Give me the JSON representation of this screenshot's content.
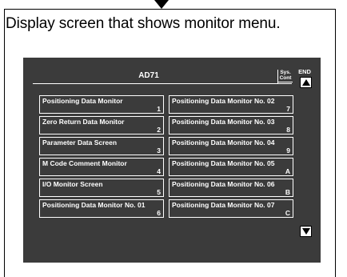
{
  "caption": "Display screen that shows monitor menu.",
  "screen": {
    "title": "AD71",
    "sys_cont_line1": "Sys.",
    "sys_cont_line2": "Cont",
    "end_label": "END"
  },
  "icons": {
    "flow": "arrow-down-icon",
    "scroll_up": "triangle-up-icon",
    "scroll_down": "triangle-down-icon"
  },
  "menu": {
    "left": [
      {
        "label": "Positioning Data Monitor",
        "number": "1"
      },
      {
        "label": "Zero Return Data Monitor",
        "number": "2"
      },
      {
        "label": "Parameter Data Screen",
        "number": "3"
      },
      {
        "label": "M Code Comment Monitor",
        "number": "4"
      },
      {
        "label": "I/O Monitor Screen",
        "number": "5"
      },
      {
        "label": "Positioning Data Monitor No. 01",
        "number": "6"
      }
    ],
    "right": [
      {
        "label": "Positioning Data Monitor No. 02",
        "number": "7"
      },
      {
        "label": "Positioning Data Monitor No. 03",
        "number": "8"
      },
      {
        "label": "Positioning Data Monitor No. 04",
        "number": "9"
      },
      {
        "label": "Positioning Data Monitor No. 05",
        "number": "A"
      },
      {
        "label": "Positioning Data Monitor No. 06",
        "number": "B"
      },
      {
        "label": "Positioning Data Monitor No. 07",
        "number": "C"
      }
    ]
  }
}
